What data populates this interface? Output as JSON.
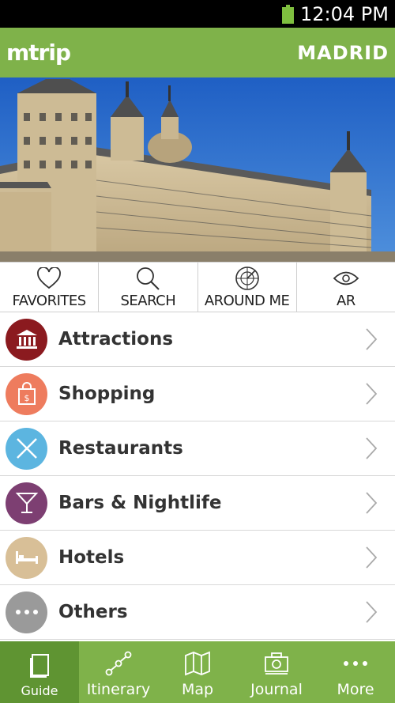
{
  "status": {
    "time": "12:04 PM"
  },
  "header": {
    "brand": "mtrip",
    "city": "MADRID"
  },
  "tools": [
    {
      "label": "FAVORITES",
      "icon": "heart-icon"
    },
    {
      "label": "SEARCH",
      "icon": "search-icon"
    },
    {
      "label": "AROUND ME",
      "icon": "radar-icon"
    },
    {
      "label": "AR",
      "icon": "eye-icon"
    }
  ],
  "categories": [
    {
      "label": "Attractions",
      "icon": "museum-icon",
      "color": "#8b1a1f"
    },
    {
      "label": "Shopping",
      "icon": "shopping-bag-icon",
      "color": "#ee7c5e"
    },
    {
      "label": "Restaurants",
      "icon": "cutlery-icon",
      "color": "#5cb5e0"
    },
    {
      "label": "Bars & Nightlife",
      "icon": "cocktail-icon",
      "color": "#7d3f72"
    },
    {
      "label": "Hotels",
      "icon": "bed-icon",
      "color": "#d8bf97"
    },
    {
      "label": "Others",
      "icon": "more-dots-icon",
      "color": "#9a9a9a"
    }
  ],
  "tabs": [
    {
      "label": "Guide",
      "icon": "book-icon",
      "active": true
    },
    {
      "label": "Itinerary",
      "icon": "route-icon",
      "active": false
    },
    {
      "label": "Map",
      "icon": "map-icon",
      "active": false
    },
    {
      "label": "Journal",
      "icon": "camera-icon",
      "active": false
    },
    {
      "label": "More",
      "icon": "more-dots-icon",
      "active": false
    }
  ],
  "colors": {
    "brand_green": "#7fb24a",
    "active_tab": "#5f9432",
    "battery": "#7fbf3f"
  }
}
